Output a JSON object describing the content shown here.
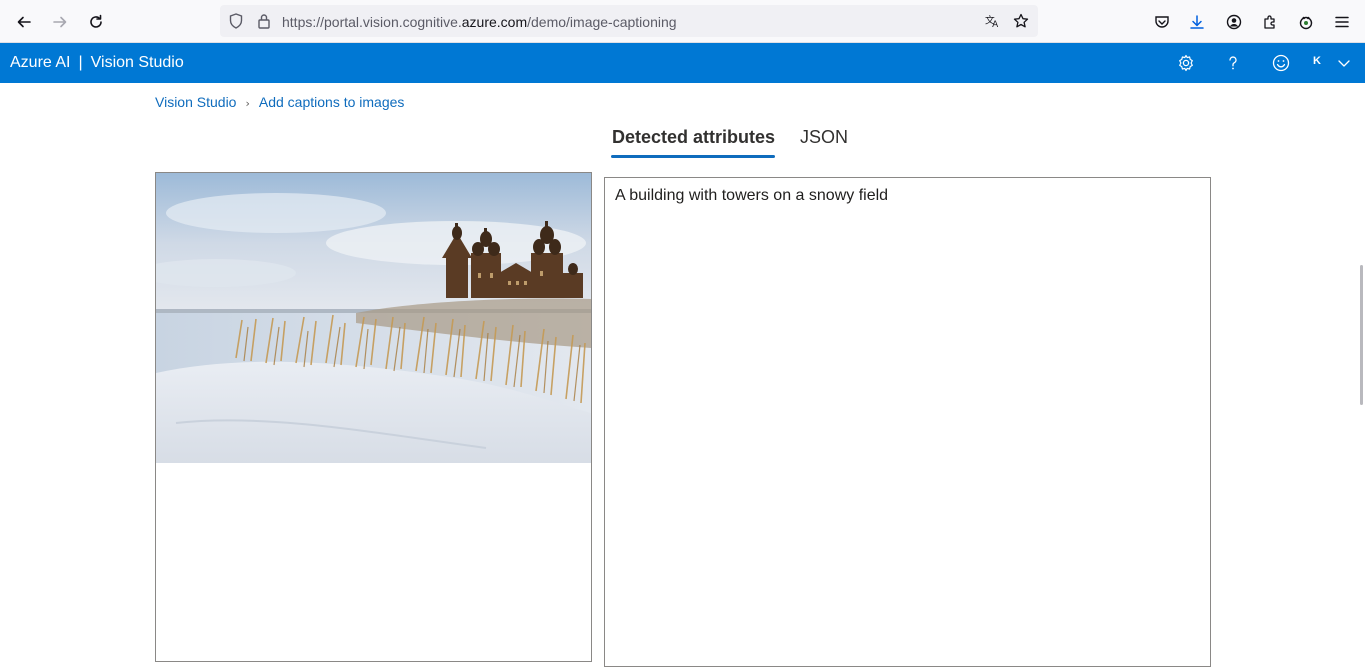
{
  "browser": {
    "url_prefix": "https://portal.vision.cognitive.",
    "url_domain": "azure.com",
    "url_path": "/demo/image-captioning",
    "icons": [
      "back-arrow-icon",
      "forward-arrow-icon",
      "reload-icon",
      "shield-icon",
      "lock-icon",
      "translate-icon",
      "bookmark-star-icon",
      "pocket-icon",
      "download-icon",
      "account-icon",
      "extensions-icon",
      "extension-icon",
      "menu-icon"
    ],
    "download_color": "#0060df"
  },
  "header": {
    "brand_primary": "Azure AI",
    "brand_separator": "|",
    "brand_secondary": "Vision Studio",
    "avatar_initial": "K",
    "background_color": "#0078d4",
    "icons": [
      "settings-gear-icon",
      "help-question-icon",
      "feedback-smiley-icon",
      "chevron-down-icon"
    ]
  },
  "breadcrumb": {
    "items": [
      "Vision Studio",
      "Add captions to images"
    ]
  },
  "tabs": [
    {
      "label": "Detected attributes",
      "active": true
    },
    {
      "label": "JSON",
      "active": false
    }
  ],
  "result": {
    "caption": "A building with towers on a snowy field"
  }
}
